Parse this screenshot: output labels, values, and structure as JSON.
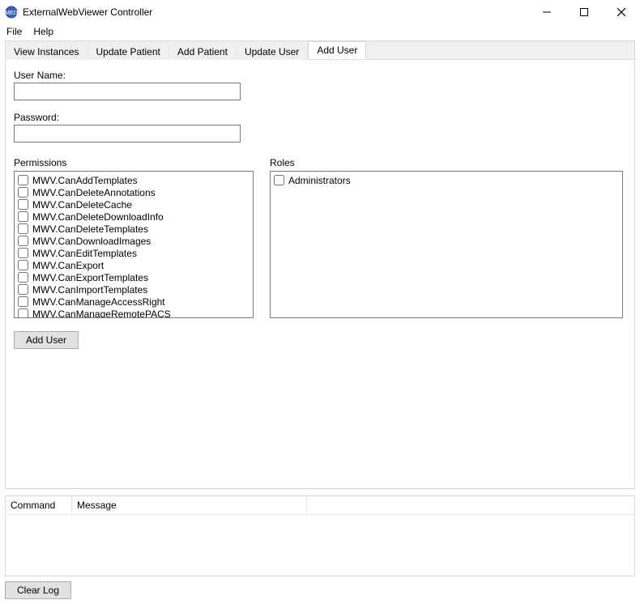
{
  "window": {
    "title": "ExternalWebViewer Controller"
  },
  "menu": {
    "file": "File",
    "help": "Help"
  },
  "tabs": [
    {
      "label": "View Instances"
    },
    {
      "label": "Update Patient"
    },
    {
      "label": "Add Patient"
    },
    {
      "label": "Update User"
    },
    {
      "label": "Add User"
    }
  ],
  "active_tab": 4,
  "form": {
    "username_label": "User Name:",
    "username_value": "",
    "password_label": "Password:",
    "password_value": ""
  },
  "permissions": {
    "label": "Permissions",
    "items": [
      "MWV.CanAddTemplates",
      "MWV.CanDeleteAnnotations",
      "MWV.CanDeleteCache",
      "MWV.CanDeleteDownloadInfo",
      "MWV.CanDeleteTemplates",
      "MWV.CanDownloadImages",
      "MWV.CanEditTemplates",
      "MWV.CanExport",
      "MWV.CanExportTemplates",
      "MWV.CanImportTemplates",
      "MWV.CanManageAccessRight",
      "MWV.CanManageRemotePACS"
    ]
  },
  "roles": {
    "label": "Roles",
    "items": [
      "Administrators"
    ]
  },
  "buttons": {
    "add_user": "Add User",
    "clear_log": "Clear Log"
  },
  "log": {
    "col_command": "Command",
    "col_message": "Message"
  }
}
